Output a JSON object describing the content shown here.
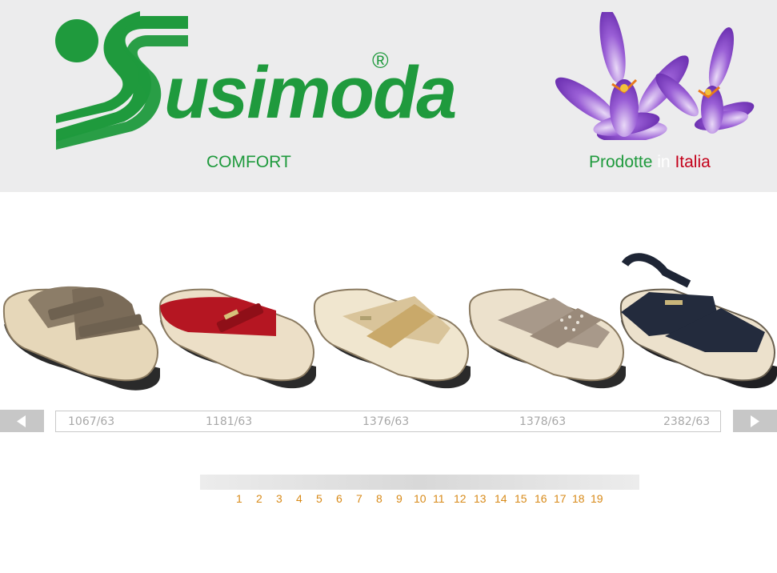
{
  "header": {
    "brand": "usimoda",
    "registered": "®",
    "tagline": "COMFORT",
    "made_in": {
      "word1": "Prodotte",
      "word2": "in",
      "word3": "Italia"
    }
  },
  "colors": {
    "brand_green": "#1f9a3d",
    "italia_red": "#c4001a",
    "pager_orange": "#d88a18",
    "caption_gray": "#a8a8a8"
  },
  "products": [
    {
      "code": "1067/63",
      "color": "bronze"
    },
    {
      "code": "1181/63",
      "color": "red"
    },
    {
      "code": "1376/63",
      "color": "beige"
    },
    {
      "code": "1378/63",
      "color": "taupe"
    },
    {
      "code": "2382/63",
      "color": "navy"
    }
  ],
  "nav": {
    "prev_icon": "arrow-left-icon",
    "next_icon": "arrow-right-icon"
  },
  "pages": [
    "1",
    "2",
    "3",
    "4",
    "5",
    "6",
    "7",
    "8",
    "9",
    "10",
    "11",
    "12",
    "13",
    "14",
    "15",
    "16",
    "17",
    "18",
    "19"
  ]
}
